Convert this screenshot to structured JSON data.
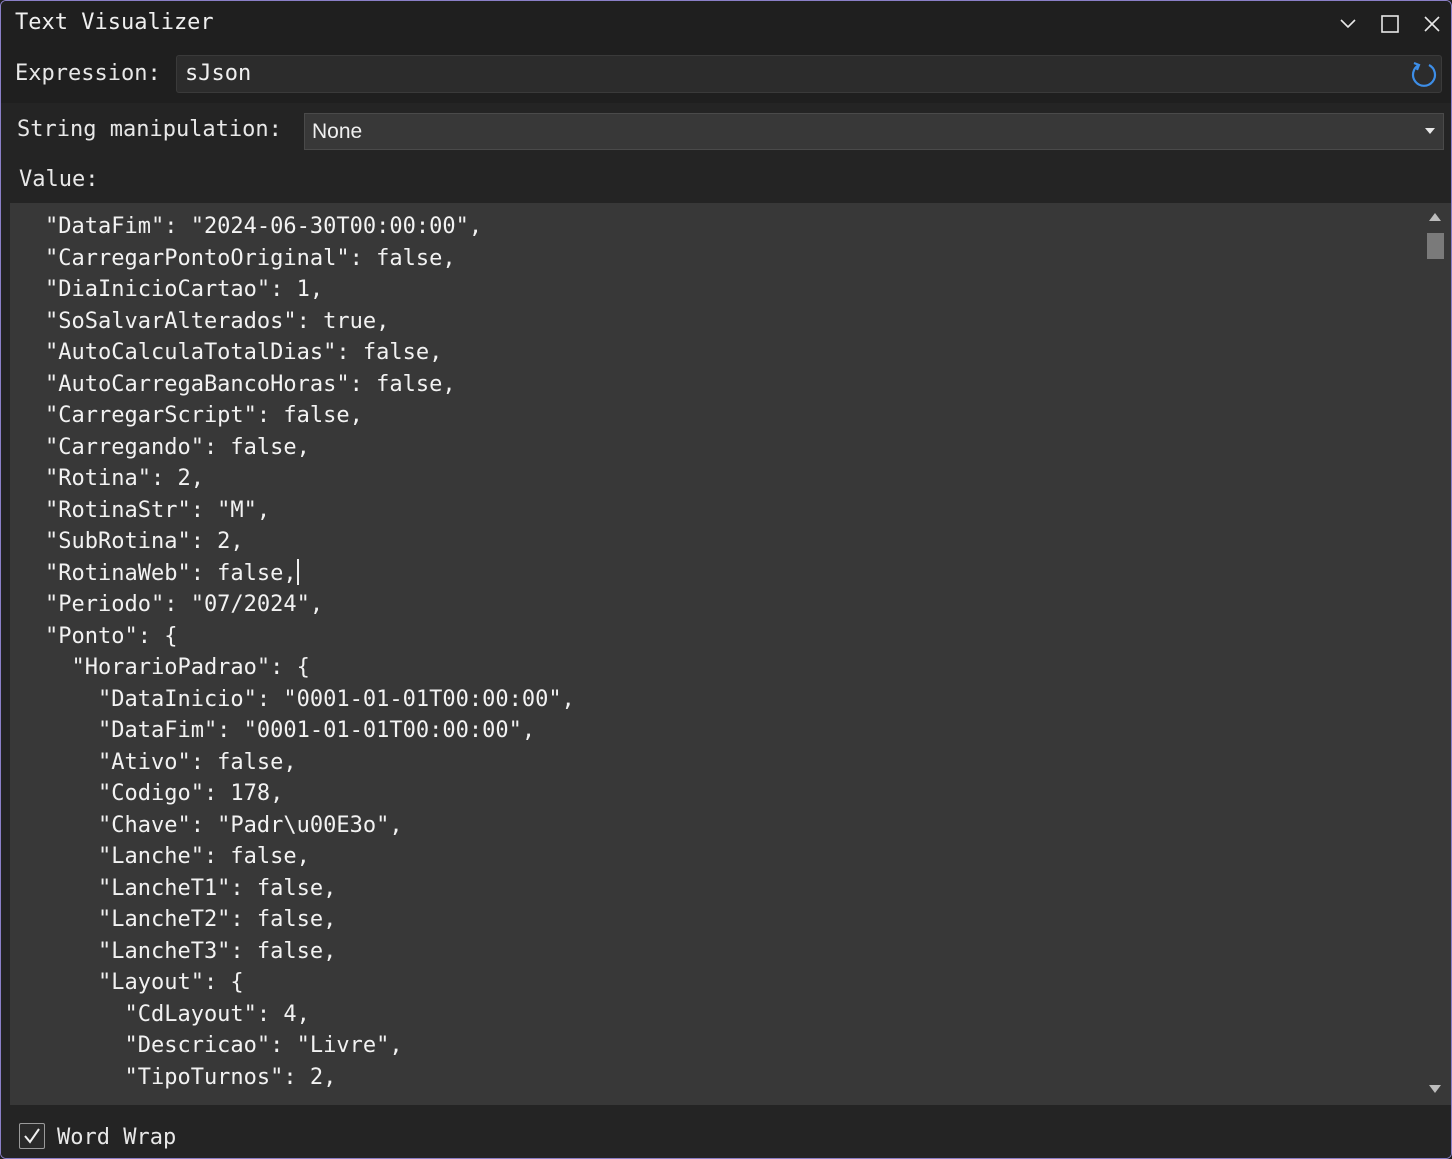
{
  "window": {
    "title": "Text Visualizer"
  },
  "expression": {
    "label": "Expression:",
    "value": "sJson"
  },
  "manipulation": {
    "label": "String manipulation:",
    "selected": "None"
  },
  "value": {
    "label": "Value:",
    "lines": [
      "\"DataFim\": \"2024-06-30T00:00:00\",",
      "\"CarregarPontoOriginal\": false,",
      "\"DiaInicioCartao\": 1,",
      "\"SoSalvarAlterados\": true,",
      "\"AutoCalculaTotalDias\": false,",
      "\"AutoCarregaBancoHoras\": false,",
      "\"CarregarScript\": false,",
      "\"Carregando\": false,",
      "\"Rotina\": 2,",
      "\"RotinaStr\": \"M\",",
      "\"SubRotina\": 2,",
      "\"RotinaWeb\": false,",
      "\"Periodo\": \"07/2024\",",
      "\"Ponto\": {",
      "  \"HorarioPadrao\": {",
      "    \"DataInicio\": \"0001-01-01T00:00:00\",",
      "    \"DataFim\": \"0001-01-01T00:00:00\",",
      "    \"Ativo\": false,",
      "    \"Codigo\": 178,",
      "    \"Chave\": \"Padr\\u00E3o\",",
      "    \"Lanche\": false,",
      "    \"LancheT1\": false,",
      "    \"LancheT2\": false,",
      "    \"LancheT3\": false,",
      "    \"Layout\": {",
      "      \"CdLayout\": 4,",
      "      \"Descricao\": \"Livre\",",
      "      \"TipoTurnos\": 2,"
    ]
  },
  "footer": {
    "word_wrap_label": "Word Wrap",
    "word_wrap_checked": true
  }
}
